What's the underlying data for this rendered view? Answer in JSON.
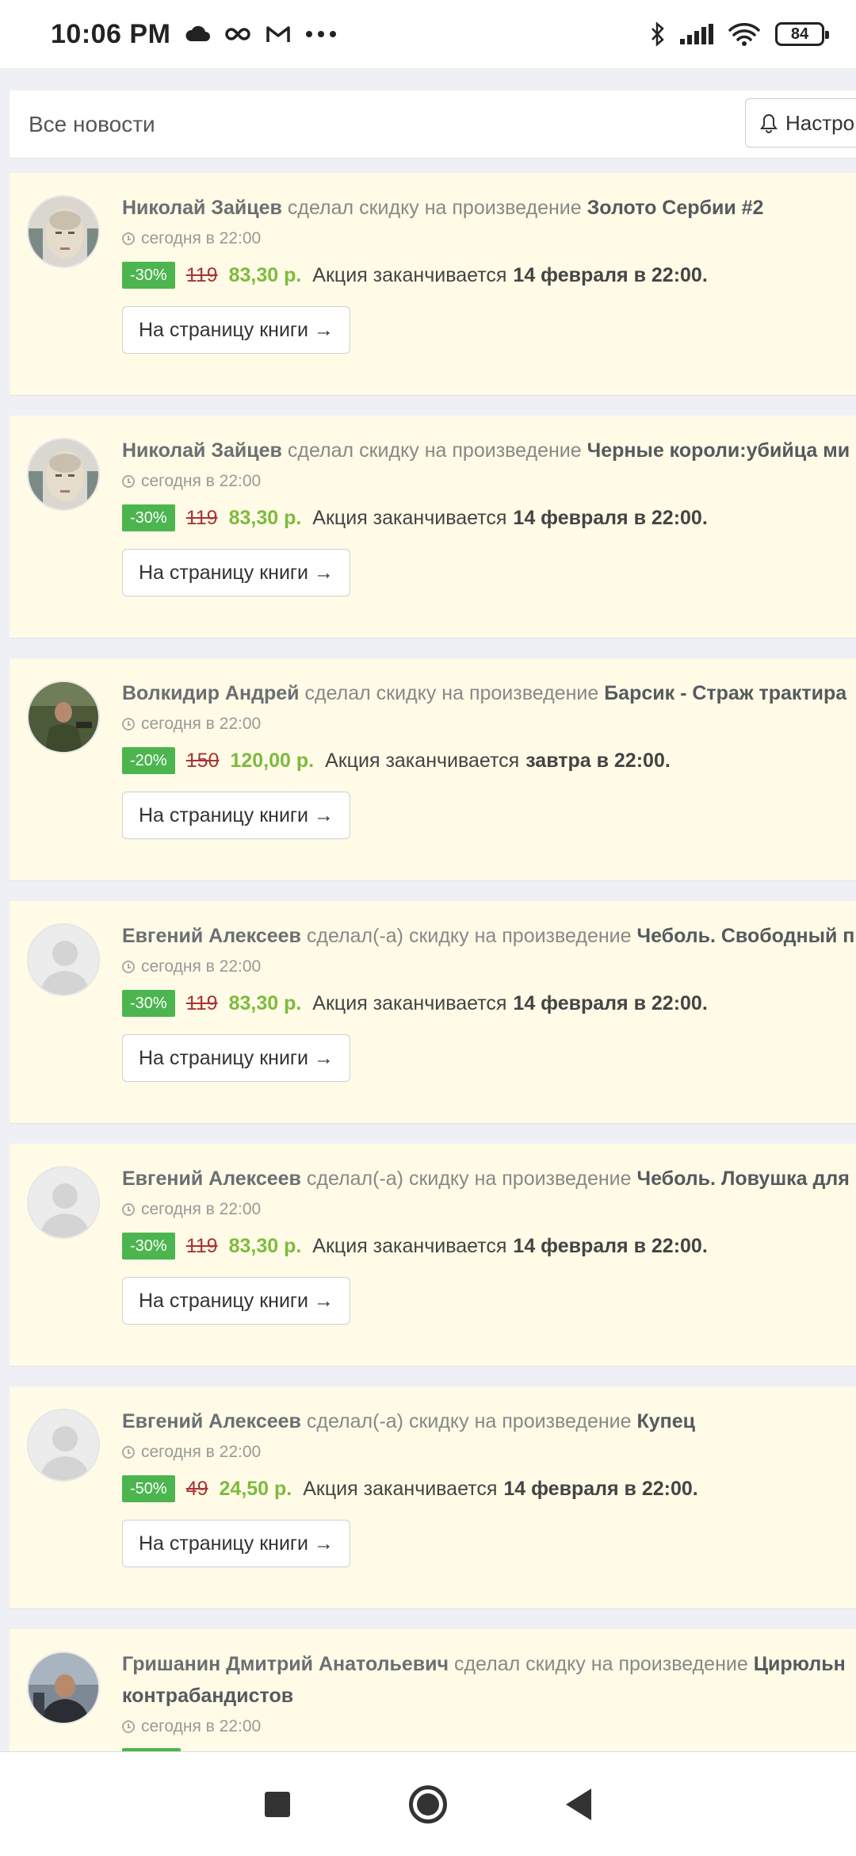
{
  "status_bar": {
    "time": "10:06 PM",
    "battery": "84",
    "icons_left": [
      "cloud-icon",
      "infinity-icon",
      "gmail-icon",
      "more-icon"
    ],
    "icons_right": [
      "bluetooth-icon",
      "signal-icon",
      "wifi-icon",
      "battery-icon"
    ]
  },
  "header": {
    "title": "Все новости",
    "settings_label": "Настро"
  },
  "common": {
    "time_text": "сегодня в 22:00",
    "ends_prefix": "Акция заканчивается",
    "button_label": "На страницу книги →"
  },
  "cards": [
    {
      "author": "Николай Зайцев",
      "verb": "сделал скидку на произведение",
      "work": "Золото Сербии #2",
      "discount": "-30%",
      "old_price": "119",
      "new_price": "83,30 р.",
      "ends": "14 февраля в 22:00."
    },
    {
      "author": "Николай Зайцев",
      "verb": "сделал скидку на произведение",
      "work": "Черные короли:убийца ми",
      "discount": "-30%",
      "old_price": "119",
      "new_price": "83,30 р.",
      "ends": "14 февраля в 22:00."
    },
    {
      "author": "Волкидир Андрей",
      "verb": "сделал скидку на произведение",
      "work": "Барсик - Страж трактира",
      "discount": "-20%",
      "old_price": "150",
      "new_price": "120,00 р.",
      "ends": "завтра в 22:00."
    },
    {
      "author": "Евгений Алексеев",
      "verb": "сделал(-а) скидку на произведение",
      "work": "Чеболь. Свободный п",
      "discount": "-30%",
      "old_price": "119",
      "new_price": "83,30 р.",
      "ends": "14 февраля в 22:00."
    },
    {
      "author": "Евгений Алексеев",
      "verb": "сделал(-а) скидку на произведение",
      "work": "Чеболь. Ловушка для",
      "discount": "-30%",
      "old_price": "119",
      "new_price": "83,30 р.",
      "ends": "14 февраля в 22:00."
    },
    {
      "author": "Евгений Алексеев",
      "verb": "сделал(-а) скидку на произведение",
      "work": "Купец",
      "discount": "-50%",
      "old_price": "49",
      "new_price": "24,50 р.",
      "ends": "14 февраля в 22:00."
    },
    {
      "author": "Гришанин Дмитрий Анатольевич",
      "verb": "сделал скидку на произведение",
      "work": "Цирюльн",
      "work_line2": "контрабандистов"
    }
  ]
}
